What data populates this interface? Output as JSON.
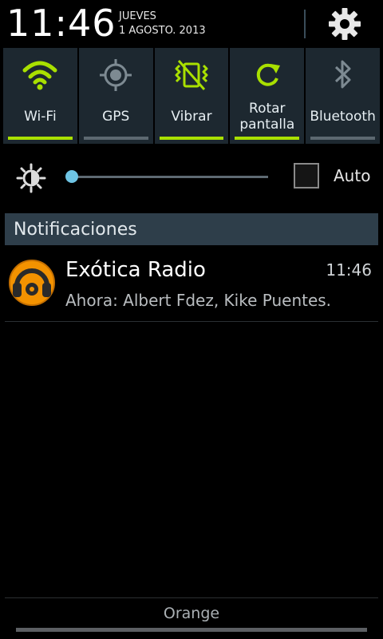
{
  "status": {
    "time": "11:46",
    "day": "JUEVES",
    "date": "1 AGOSTO. 2013"
  },
  "icons": {
    "settings": "gear-icon",
    "wifi": "wifi-icon",
    "gps": "gps-icon",
    "vibrate": "vibrate-icon",
    "rotate": "rotate-icon",
    "bluetooth": "bluetooth-icon",
    "brightness": "brightness-icon"
  },
  "toggles": [
    {
      "label": "Wi-Fi",
      "state": "on"
    },
    {
      "label": "GPS",
      "state": "off"
    },
    {
      "label": "Vibrar",
      "state": "on"
    },
    {
      "label_line1": "Rotar",
      "label_line2": "pantalla",
      "state": "on"
    },
    {
      "label": "Bluetooth",
      "state": "off"
    }
  ],
  "brightness": {
    "level": 0.0,
    "auto_label": "Auto",
    "auto_checked": false
  },
  "notifications": {
    "header": "Notificaciones",
    "items": [
      {
        "title": "Exótica Radio",
        "time": "11:46",
        "text": "Ahora: Albert Fdez, Kike Puentes."
      }
    ]
  },
  "carrier": "Orange",
  "colors": {
    "accent_on": "#a9e000",
    "accent_off": "#5c6870",
    "slider_thumb": "#6ec4e4",
    "notif_icon": "#f39200"
  }
}
